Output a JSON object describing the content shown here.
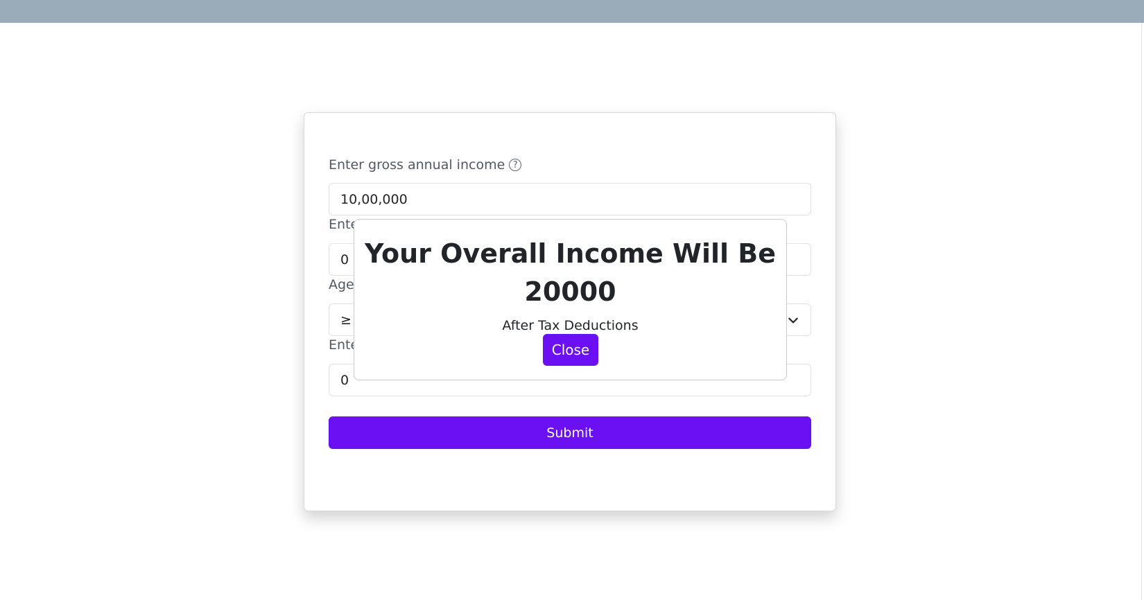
{
  "colors": {
    "accent": "#6a10f2",
    "topbar": "#9aabb9",
    "label": "#515861",
    "border": "#dee2e6"
  },
  "form": {
    "income_label": "Enter gross annual income",
    "income_help_icon": "question-circle-icon",
    "income_value": "10,00,000",
    "field2_label_visible": "Ente",
    "field2_value": "0",
    "age_label_visible": "Age",
    "age_value_visible": "≥",
    "field4_label_visible": "Ente",
    "field4_value": "0",
    "submit_label": "Submit"
  },
  "modal": {
    "heading": "Your Overall Income Will Be 20000",
    "subtext": "After Tax Deductions",
    "close_label": "Close"
  }
}
